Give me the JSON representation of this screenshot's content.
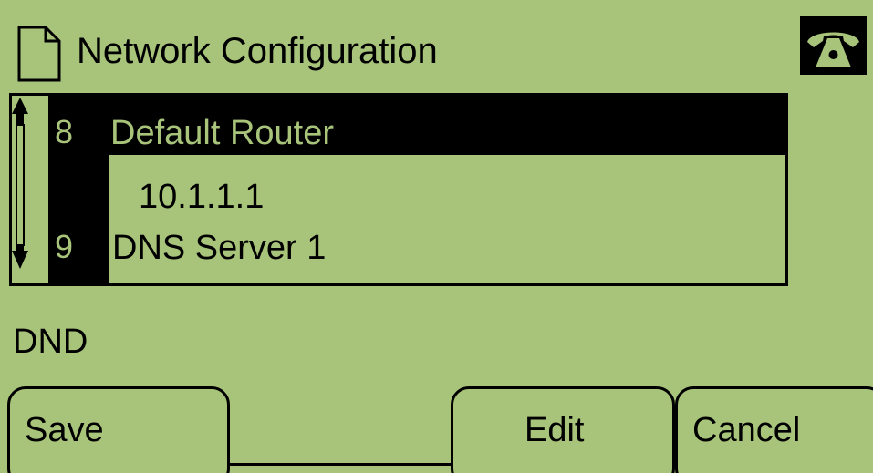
{
  "header": {
    "title": "Network Configuration",
    "left_icon": "document-icon",
    "status_icon": "phone-handset-icon"
  },
  "list": {
    "scroll_icon": "vertical-scroll-arrows-icon",
    "rows": [
      {
        "number": "8",
        "label": "Default Router",
        "value": "10.1.1.1",
        "selected": true
      },
      {
        "number": "9",
        "label": "DNS Server 1"
      }
    ]
  },
  "status": {
    "text": "DND"
  },
  "softkeys": {
    "save": "Save",
    "edit": "Edit",
    "cancel": "Cancel"
  },
  "colors": {
    "lcd_background": "#a8c47a",
    "foreground": "#000000"
  }
}
